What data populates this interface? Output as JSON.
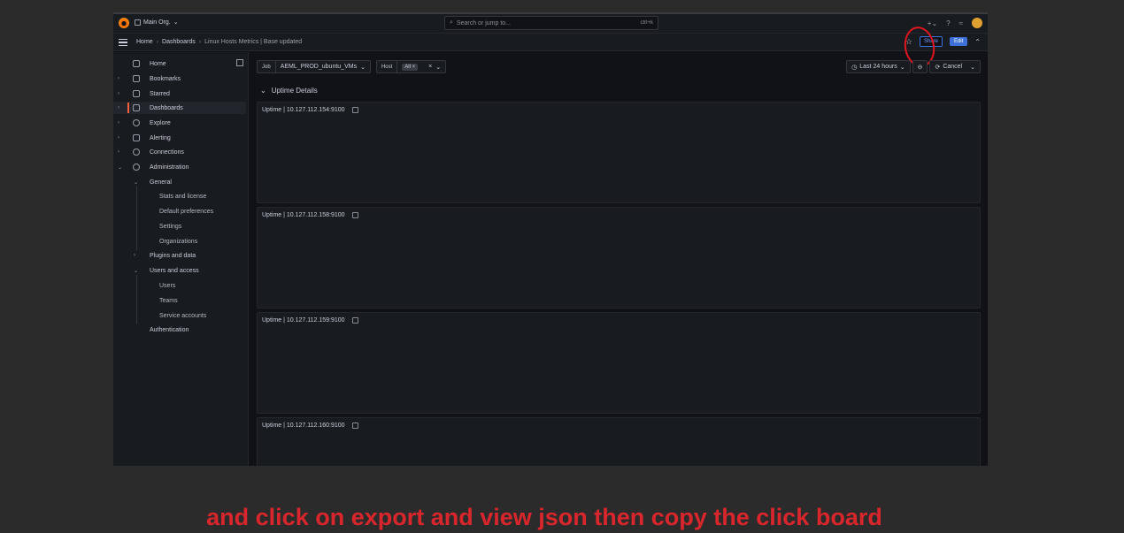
{
  "topbar": {
    "org": "Main Org.",
    "search_placeholder": "Search or jump to...",
    "search_shortcut": "ctrl+k"
  },
  "breadcrumb": {
    "home": "Home",
    "dashboards": "Dashboards",
    "current": "Linux Hosts Metrics | Base updated"
  },
  "actions": {
    "share": "Share",
    "edit": "Edit"
  },
  "sidebar": {
    "items": [
      {
        "label": "Home",
        "icon": "home-icon"
      },
      {
        "label": "Bookmarks",
        "icon": "bookmark-icon"
      },
      {
        "label": "Starred",
        "icon": "star-icon"
      },
      {
        "label": "Dashboards",
        "icon": "dashboards-icon"
      },
      {
        "label": "Explore",
        "icon": "compass-icon"
      },
      {
        "label": "Alerting",
        "icon": "bell-icon"
      },
      {
        "label": "Connections",
        "icon": "link-icon"
      },
      {
        "label": "Administration",
        "icon": "gear-icon"
      },
      {
        "label": "General"
      },
      {
        "label": "Stats and license"
      },
      {
        "label": "Default preferences"
      },
      {
        "label": "Settings"
      },
      {
        "label": "Organizations"
      },
      {
        "label": "Plugins and data"
      },
      {
        "label": "Users and access"
      },
      {
        "label": "Users"
      },
      {
        "label": "Teams"
      },
      {
        "label": "Service accounts"
      },
      {
        "label": "Authentication"
      }
    ]
  },
  "variables": {
    "job_label": "Job",
    "job_value": "AEML_PROD_ubuntu_VMs",
    "host_label": "Host",
    "host_value": "All"
  },
  "timepicker": {
    "range": "Last 24 hours",
    "cancel": "Cancel"
  },
  "row": {
    "title": "Uptime Details"
  },
  "panels": [
    {
      "title": "Uptime | 10.127.112.154:9100"
    },
    {
      "title": "Uptime | 10.127.112.158:9100"
    },
    {
      "title": "Uptime | 10.127.112.159:9100"
    },
    {
      "title": "Uptime | 10.127.112.160:9100"
    }
  ],
  "caption": "and click on export and view json then copy the click board",
  "colors": {
    "accent": "#3d71d9",
    "annotation": "#d9262c"
  }
}
